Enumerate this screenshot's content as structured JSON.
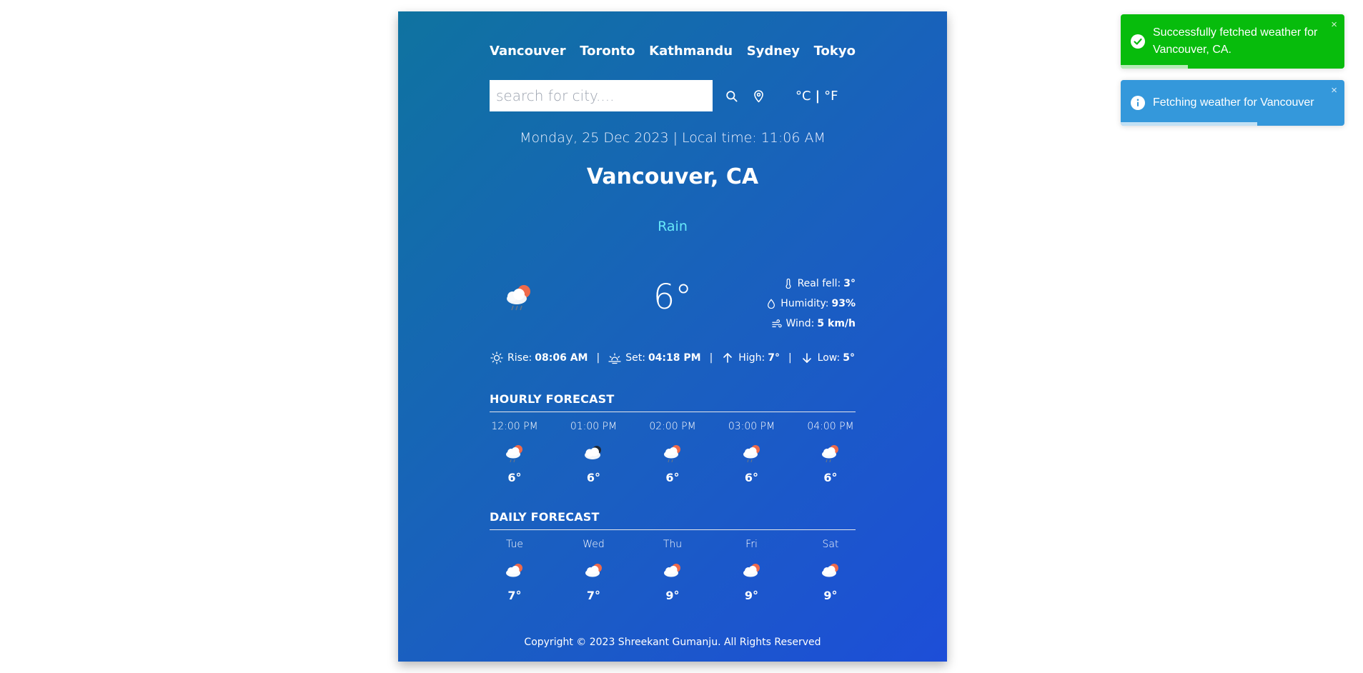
{
  "cities": [
    "Vancouver",
    "Toronto",
    "Kathmandu",
    "Sydney",
    "Tokyo"
  ],
  "search": {
    "placeholder": "search for city....",
    "value": ""
  },
  "icons": {
    "search": "search-icon",
    "location": "location-pin-icon",
    "weather": "cloud-sun-rain-icon"
  },
  "units": {
    "celsius": "°C",
    "separator": "|",
    "fahrenheit": "°F"
  },
  "current": {
    "datetime": "Monday, 25 Dec 2023 | Local time: 11:06 AM",
    "location": "Vancouver, CA",
    "condition": "Rain",
    "temperature": "6°",
    "real_feel_label": "Real fell:",
    "real_feel_value": "3°",
    "humidity_label": "Humidity:",
    "humidity_value": "93%",
    "wind_label": "Wind:",
    "wind_value": "5 km/h"
  },
  "sun": {
    "rise_label": "Rise:",
    "rise_value": "08:06 AM",
    "set_label": "Set:",
    "set_value": "04:18 PM",
    "high_label": "High:",
    "high_value": "7°",
    "low_label": "Low:",
    "low_value": "5°",
    "separator": "|"
  },
  "hourly": {
    "title": "Hourly forecast",
    "items": [
      {
        "label": "12:00 PM",
        "temp": "6°",
        "icon": "cloud-sun-rain-icon"
      },
      {
        "label": "01:00 PM",
        "temp": "6°",
        "icon": "cloud-moon-icon"
      },
      {
        "label": "02:00 PM",
        "temp": "6°",
        "icon": "cloud-sun-rain-icon"
      },
      {
        "label": "03:00 PM",
        "temp": "6°",
        "icon": "cloud-sun-rain-icon"
      },
      {
        "label": "04:00 PM",
        "temp": "6°",
        "icon": "cloud-sun-rain-icon"
      }
    ]
  },
  "daily": {
    "title": "Daily forecast",
    "items": [
      {
        "label": "Tue",
        "temp": "7°",
        "icon": "cloud-sun-icon"
      },
      {
        "label": "Wed",
        "temp": "7°",
        "icon": "cloud-sun-icon"
      },
      {
        "label": "Thu",
        "temp": "9°",
        "icon": "cloud-sun-icon"
      },
      {
        "label": "Fri",
        "temp": "9°",
        "icon": "cloud-sun-icon"
      },
      {
        "label": "Sat",
        "temp": "9°",
        "icon": "cloud-sun-icon"
      }
    ]
  },
  "footer": {
    "copyright": "Copyright © 2023 Shreekant Gumanju. All Rights Reserved"
  },
  "toasts": {
    "success": {
      "message": "Successfully fetched weather for Vancouver, CA.",
      "close": "×",
      "icon": "check-circle-icon",
      "progress": 0.3
    },
    "info": {
      "message": "Fetching weather for Vancouver",
      "close": "×",
      "icon": "info-circle-icon",
      "progress": 0.61
    }
  },
  "colors": {
    "gradient_start": "#0f73a0",
    "gradient_end": "#1d4ed8",
    "condition": "#67e8f9",
    "toast_success": "#07bc0c",
    "toast_info": "#3498db"
  }
}
